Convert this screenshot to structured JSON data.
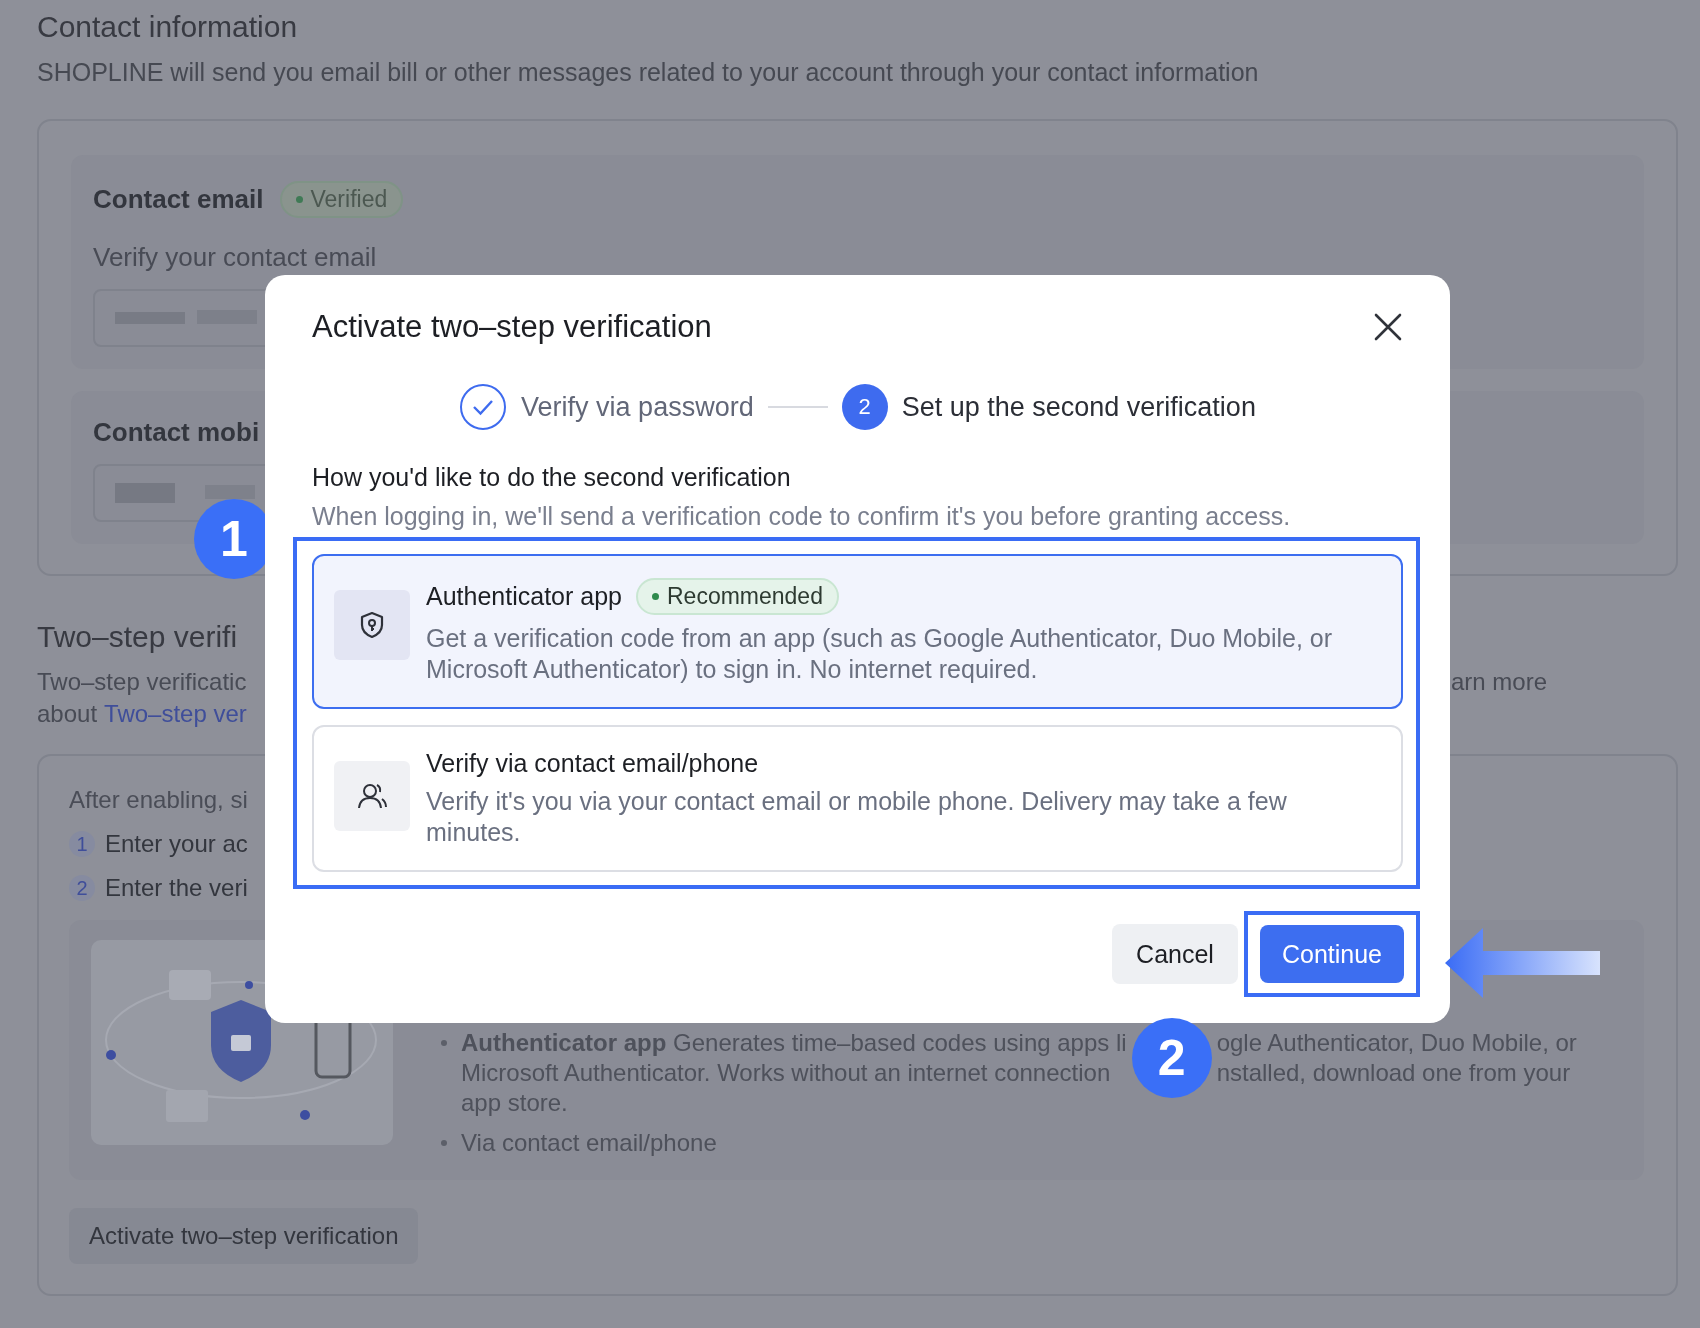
{
  "background": {
    "title": "Contact information",
    "description": "SHOPLINE will send you email bill or other messages related to your account through your contact information",
    "contact_email": {
      "label": "Contact email",
      "badge": "Verified",
      "hint": "Verify your contact email"
    },
    "contact_mobile": {
      "label": "Contact mobi"
    },
    "two_step": {
      "title": "Two–step verifi",
      "description_start": "Two–step verificatic",
      "description_end": "arn more",
      "about": "about",
      "link": "Two–step ver",
      "intro": "After enabling, si",
      "steps": [
        {
          "number": "1",
          "text": "Enter your ac"
        },
        {
          "number": "2",
          "text": "Enter the veri"
        }
      ],
      "bullets": [
        {
          "lines": [
            [
              "**Authenticator app** Generates time–based codes using apps li",
              "ogle Authenticator, Duo Mobile, or"
            ],
            [
              "Microsoft Authenticator. Works without an internet connection",
              "nstalled, download one from your"
            ],
            [
              "app store."
            ]
          ]
        },
        {
          "lines": [
            [
              "Via contact email/phone"
            ]
          ]
        }
      ],
      "button": "Activate two–step verification"
    }
  },
  "modal": {
    "title": "Activate two–step verification",
    "steps": [
      {
        "kind": "done",
        "label": "Verify via password"
      },
      {
        "kind": "current",
        "number": "2",
        "label": "Set up the second verification"
      }
    ],
    "heading": "How you'd like to do the second verification",
    "description": "When logging in, we'll send a verification code to confirm it's you before granting access.",
    "options": [
      {
        "kind": "authenticator",
        "title": "Authenticator app",
        "badge": "Recommended",
        "description": "Get a verification code from an app (such as Google Authenticator, Duo Mobile, or Microsoft Authenticator) to sign in. No internet required.",
        "selected": true
      },
      {
        "kind": "contact",
        "title": "Verify via contact email/phone",
        "description": "Verify it's you via your contact email or mobile phone. Delivery may take a few minutes.",
        "selected": false
      }
    ],
    "buttons": {
      "cancel": "Cancel",
      "continue": "Continue"
    }
  },
  "annotations": [
    "1",
    "2"
  ]
}
